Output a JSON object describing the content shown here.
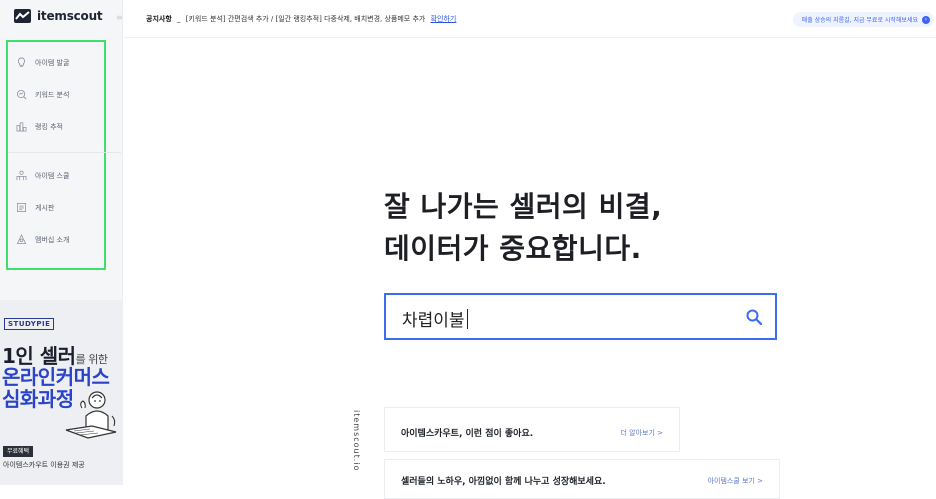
{
  "app": {
    "brand": "itemscout",
    "collapse_glyph": "≡"
  },
  "sidebar": {
    "items": [
      {
        "label": "아이템 발굴",
        "icon": "lightbulb-icon"
      },
      {
        "label": "키워드 분석",
        "icon": "search-analysis-icon"
      },
      {
        "label": "랭킹 추적",
        "icon": "bar-chart-icon"
      },
      {
        "label": "아이템 스쿨",
        "icon": "school-icon"
      },
      {
        "label": "게시판",
        "icon": "board-icon"
      },
      {
        "label": "멤버십 소개",
        "icon": "membership-icon"
      }
    ],
    "highlight_color": "#3ee06b"
  },
  "ad": {
    "badge": "STUDYPIE",
    "line1_big": "1인 셀러",
    "line1_small": "를 위한",
    "line2": "온라인커머스",
    "line3": "심화과정",
    "free_tag": "무료혜택",
    "sub": "아이템스카우트 이용권 제공"
  },
  "topbar": {
    "notice_label": "공지사항",
    "notice_sep": "_",
    "notice_text": "[키워드 분석] 간편검색 추가 / [일간 랭킹추적] 다중삭제, 배치변경, 상품메모 추가",
    "notice_link": "확인하기",
    "promo_text": "매출 상승의 지름길, 지금 무료로 시작해보세요",
    "promo_icon_text": "›"
  },
  "hero": {
    "line1": "잘 나가는 셀러의 비결,",
    "line2": "데이터가 중요합니다."
  },
  "search": {
    "value": "차렵이불"
  },
  "vertical_url": "itemscout.io",
  "cards": [
    {
      "title": "아이템스카우트, 이런 점이 좋아요.",
      "link": "더 알아보기 >"
    },
    {
      "title": "셀러들의 노하우, 아낌없이 함께 나누고 성장해보세요.",
      "link": "아이템스쿨 보기 >"
    }
  ],
  "colors": {
    "accent": "#3a6df0",
    "link": "#2a50e8",
    "ad_blue": "#2a43c8"
  }
}
